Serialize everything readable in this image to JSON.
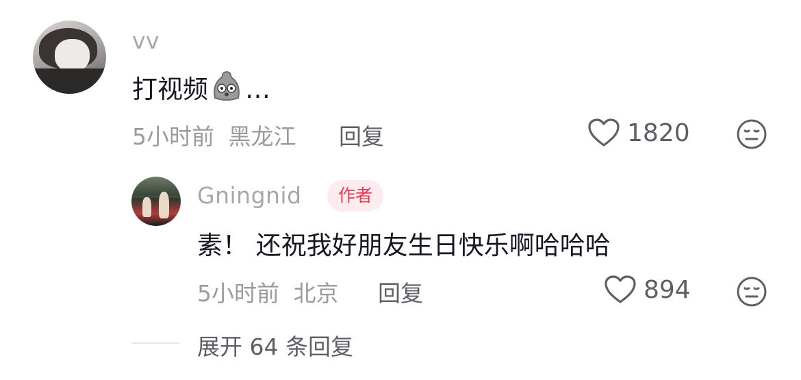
{
  "comment": {
    "username": "vv",
    "text": "打视频",
    "ellipsis": "…",
    "emoji_icon": "sack-face-emoji",
    "time": "5小时前",
    "location": "黑龙江",
    "reply_label": "回复",
    "like_count": "1820"
  },
  "reply": {
    "username": "Gningnid",
    "author_badge": "作者",
    "text": "素！ 还祝我好朋友生日快乐啊哈哈哈",
    "time": "5小时前",
    "location": "北京",
    "reply_label": "回复",
    "like_count": "894"
  },
  "expand_label": "展开 64 条回复",
  "colors": {
    "badge_text": "#f0364f",
    "badge_bg": "#fdecef",
    "meta": "#9a9aa0"
  }
}
